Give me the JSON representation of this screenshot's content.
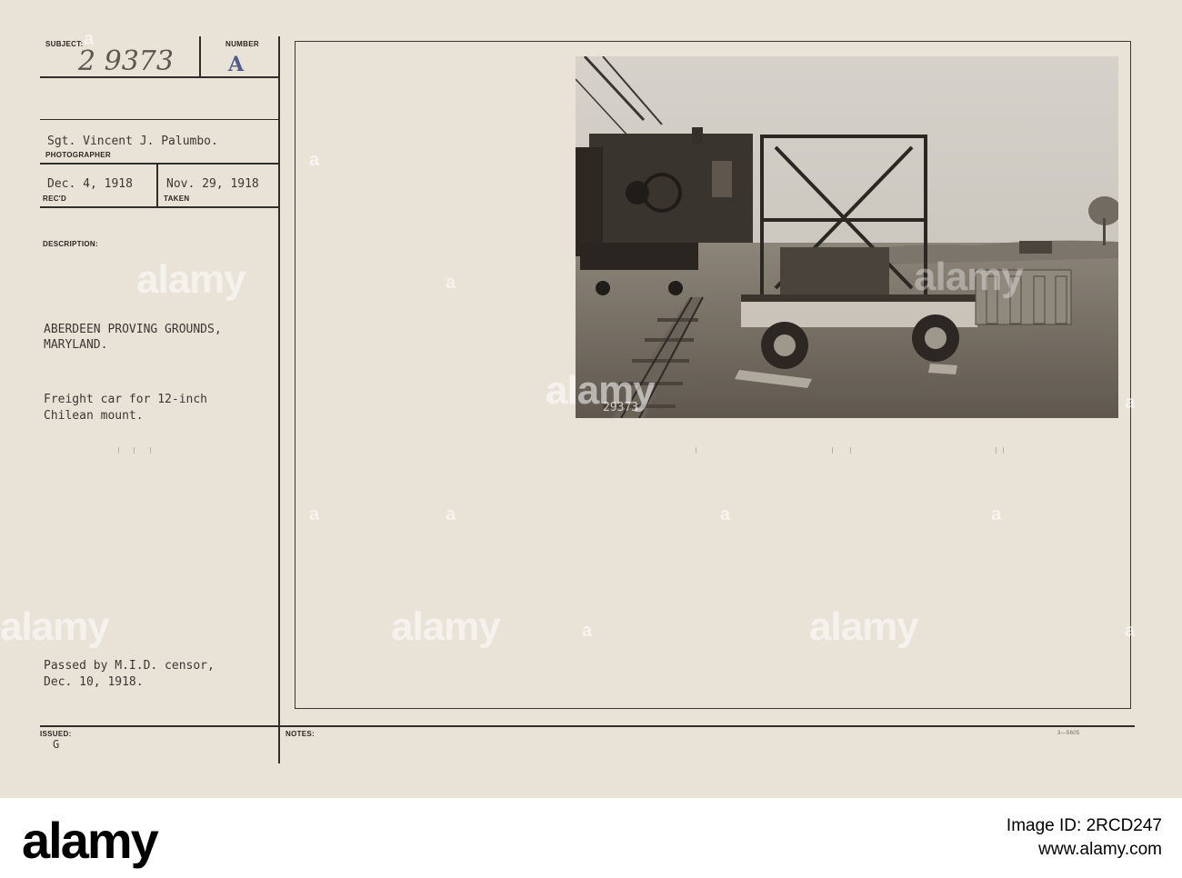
{
  "card": {
    "subject_label": "SUBJECT:",
    "subject_value": "2 9373",
    "number_label": "NUMBER",
    "number_value": "A",
    "photographer_name": "Sgt. Vincent J. Palumbo.",
    "photographer_label": "PHOTOGRAPHER",
    "received_date": "Dec. 4, 1918",
    "received_label": "REC'D",
    "taken_date": "Nov. 29, 1918",
    "taken_label": "TAKEN",
    "description_label": "DESCRIPTION:",
    "location_line1": "ABERDEEN PROVING GROUNDS,",
    "location_line2": "MARYLAND.",
    "caption_line1": "Freight car for 12-inch",
    "caption_line2": "Chilean mount.",
    "censor_line1": "Passed by M.I.D. censor,",
    "censor_line2": "Dec. 10, 1918.",
    "issued_label": "ISSUED:",
    "issued_value": "G",
    "notes_label": "NOTES:",
    "form_number": "3—5605",
    "photo_number": "29373"
  },
  "watermark": {
    "text": "alamy"
  },
  "alamy_bar": {
    "logo": "alamy",
    "image_id_line": "Image ID: 2RCD247",
    "url": "www.alamy.com"
  }
}
